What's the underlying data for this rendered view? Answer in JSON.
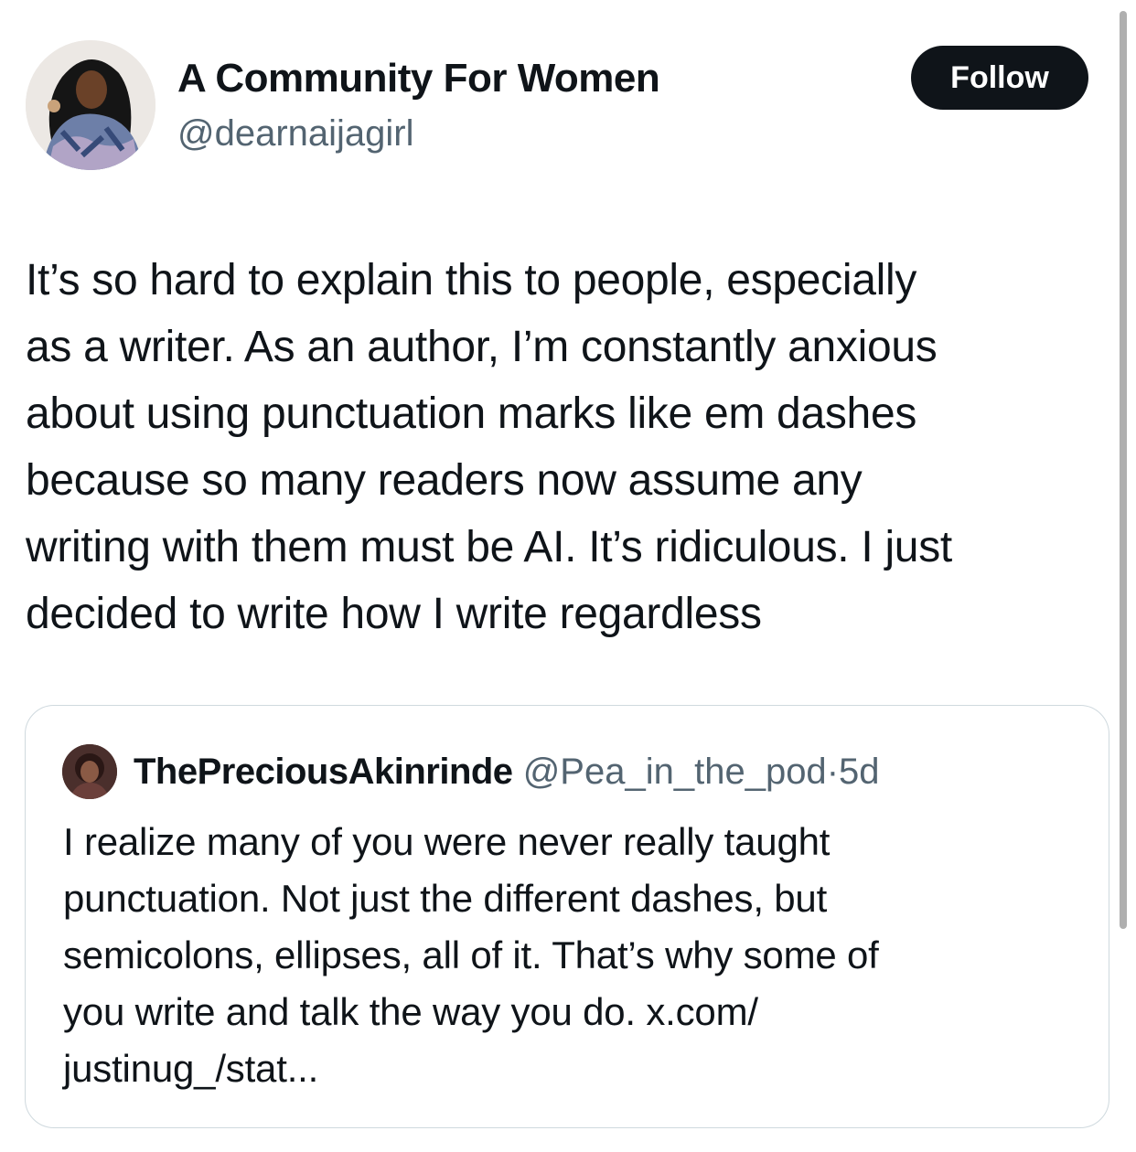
{
  "author": {
    "display_name": "A Community For Women",
    "handle": "@dearnaijagirl",
    "avatar_icon": "profile-photo"
  },
  "follow_button": {
    "label": "Follow"
  },
  "tweet": {
    "lines": [
      "It’s so hard to explain this to people, especially",
      "as a writer. As an author, I’m constantly anxious",
      "about using punctuation marks like em dashes",
      "because so many readers now assume any",
      "writing with them must be AI. It’s ridiculous. I just",
      "decided to write how I write regardless"
    ]
  },
  "quoted_tweet": {
    "display_name": "ThePreciousAkinrinde",
    "handle": "@Pea_in_the_pod",
    "separator": "·",
    "time": "5d",
    "lines": [
      "I realize many of you were never really taught",
      "punctuation. Not just the different dashes, but",
      "semicolons, ellipses, all of it. That’s why some of",
      "you write and talk the way you do. x.com/",
      "justinug_/stat..."
    ]
  },
  "colors": {
    "text": "#0f1419",
    "secondary_text": "#536471",
    "button_background": "#0f1419",
    "button_text": "#ffffff",
    "card_border": "#cfd9de"
  }
}
